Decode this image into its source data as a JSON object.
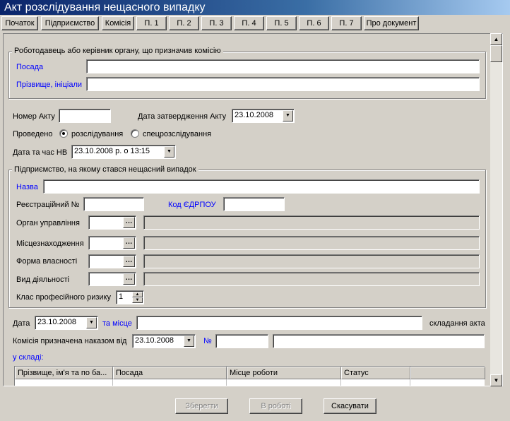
{
  "window": {
    "title": "Акт розслідування нещасного випадку"
  },
  "tabs": [
    "Початок",
    "Підприємство",
    "Комісія",
    "П. 1",
    "П. 2",
    "П. 3",
    "П. 4",
    "П. 5",
    "П. 6",
    "П. 7",
    "Про документ"
  ],
  "employer": {
    "legend": "Роботодавець або керівник органу, що призначив комісію",
    "position_label": "Посада",
    "position_value": "",
    "name_label": "Прізвище, ініціали",
    "name_value": ""
  },
  "act": {
    "number_label": "Номер Акту",
    "number_value": "",
    "approval_date_label": "Дата затвердження Акту",
    "approval_date_value": "23.10.2008",
    "conducted_label": "Проведено",
    "option_investigation": "розслідування",
    "option_special": "спецрозслідування",
    "selected_option": "розслідування",
    "accident_datetime_label": "Дата та час НВ",
    "accident_datetime_value": "23.10.2008 р. о 13:15"
  },
  "enterprise": {
    "legend": "Підприємство, на якому стався нещасний випадок",
    "name_label": "Назва",
    "name_value": "",
    "reg_no_label": "Реєстраційний №",
    "reg_no_value": "",
    "edrpou_label": "Код  ЄДРПОУ",
    "edrpou_value": "",
    "management_label": "Орган управління",
    "location_label": "Місцезнаходження",
    "ownership_label": "Форма власності",
    "activity_label": "Вид діяльності",
    "risk_class_label": "Клас професійного ризику",
    "risk_class_value": "1"
  },
  "compile": {
    "date_label": "Дата",
    "date_value": "23.10.2008",
    "place_label": "та місце",
    "place_value": "",
    "suffix_label": "складання акта"
  },
  "commission": {
    "order_label": "Комісія призначена наказом від",
    "order_date_value": "23.10.2008",
    "number_label": "№",
    "number_value": "",
    "extra_value": "",
    "members_label": "у складі:",
    "columns": [
      "Прізвище, ім'я та по ба...",
      "Посада",
      "Місце роботи",
      "Статус"
    ]
  },
  "footer": {
    "save": "Зберегти",
    "in_work": "В роботі",
    "cancel": "Скасувати"
  }
}
